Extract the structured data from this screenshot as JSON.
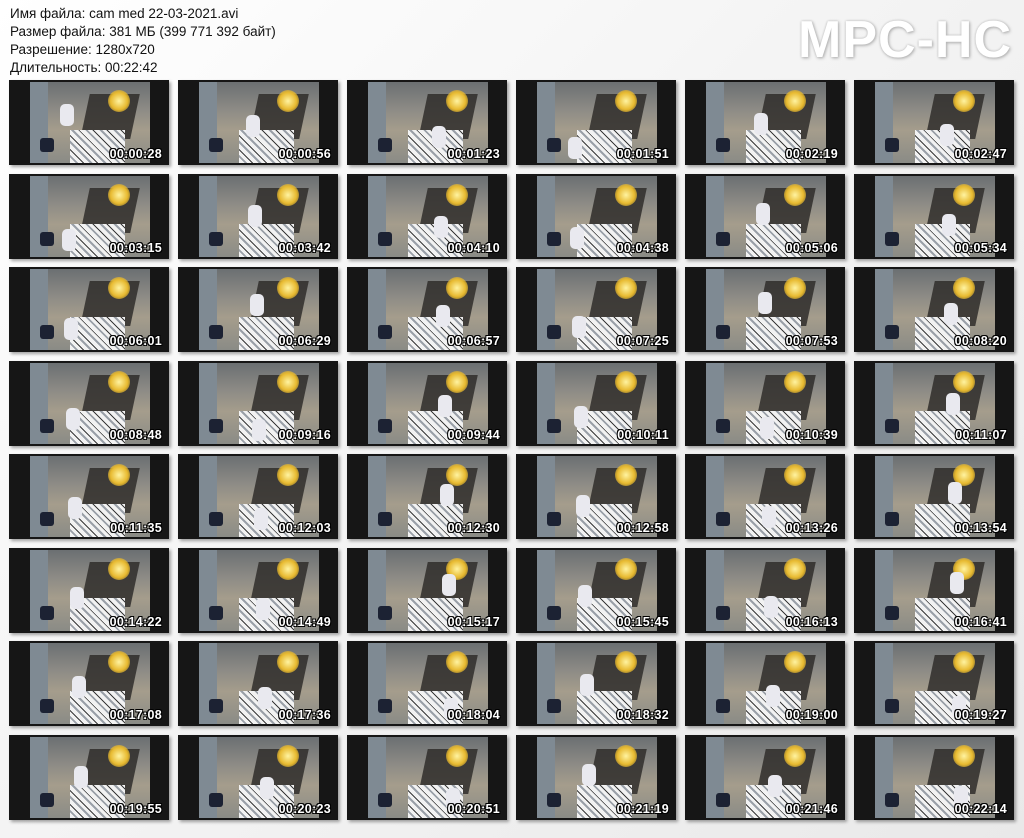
{
  "info": {
    "filename": "Имя файла: cam med 22-03-2021.avi",
    "filesize": "Размер файла: 381 МБ (399 771 392 байт)",
    "resolution": "Разрешение: 1280x720",
    "duration": "Длительность: 00:22:42"
  },
  "logo": "MPC-HC",
  "thumbnails": [
    "00:00:28",
    "00:00:56",
    "00:01:23",
    "00:01:51",
    "00:02:19",
    "00:02:47",
    "00:03:15",
    "00:03:42",
    "00:04:10",
    "00:04:38",
    "00:05:06",
    "00:05:34",
    "00:06:01",
    "00:06:29",
    "00:06:57",
    "00:07:25",
    "00:07:53",
    "00:08:20",
    "00:08:48",
    "00:09:16",
    "00:09:44",
    "00:10:11",
    "00:10:39",
    "00:11:07",
    "00:11:35",
    "00:12:03",
    "00:12:30",
    "00:12:58",
    "00:13:26",
    "00:13:54",
    "00:14:22",
    "00:14:49",
    "00:15:17",
    "00:15:45",
    "00:16:13",
    "00:16:41",
    "00:17:08",
    "00:17:36",
    "00:18:04",
    "00:18:32",
    "00:19:00",
    "00:19:27",
    "00:19:55",
    "00:20:23",
    "00:20:51",
    "00:21:19",
    "00:21:46",
    "00:22:14"
  ]
}
